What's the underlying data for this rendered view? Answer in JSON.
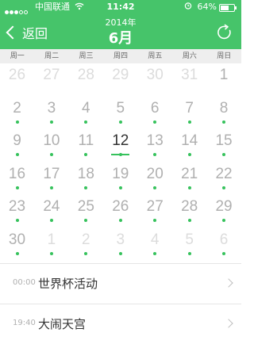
{
  "status_bar": {
    "carrier": "中国联通",
    "time": "11:42",
    "battery_pct": "64%",
    "battery_level": 0.64
  },
  "header": {
    "back_label": "返回",
    "year": "2014年",
    "month": "6月"
  },
  "weekdays": [
    "周一",
    "周二",
    "周三",
    "周四",
    "周五",
    "周六",
    "周日"
  ],
  "calendar": {
    "weeks": [
      [
        {
          "d": "26",
          "m": "prev"
        },
        {
          "d": "27",
          "m": "prev"
        },
        {
          "d": "28",
          "m": "prev"
        },
        {
          "d": "29",
          "m": "prev"
        },
        {
          "d": "30",
          "m": "prev"
        },
        {
          "d": "31",
          "m": "prev"
        },
        {
          "d": "1",
          "m": "cur"
        }
      ],
      [
        {
          "d": "2",
          "m": "cur"
        },
        {
          "d": "3",
          "m": "cur"
        },
        {
          "d": "4",
          "m": "cur"
        },
        {
          "d": "5",
          "m": "cur"
        },
        {
          "d": "6",
          "m": "cur"
        },
        {
          "d": "7",
          "m": "cur"
        },
        {
          "d": "8",
          "m": "cur"
        }
      ],
      [
        {
          "d": "9",
          "m": "cur"
        },
        {
          "d": "10",
          "m": "cur"
        },
        {
          "d": "11",
          "m": "cur"
        },
        {
          "d": "12",
          "m": "cur",
          "today": true
        },
        {
          "d": "13",
          "m": "cur"
        },
        {
          "d": "14",
          "m": "cur"
        },
        {
          "d": "15",
          "m": "cur"
        }
      ],
      [
        {
          "d": "16",
          "m": "cur"
        },
        {
          "d": "17",
          "m": "cur"
        },
        {
          "d": "18",
          "m": "cur"
        },
        {
          "d": "19",
          "m": "cur"
        },
        {
          "d": "20",
          "m": "cur"
        },
        {
          "d": "21",
          "m": "cur"
        },
        {
          "d": "22",
          "m": "cur"
        }
      ],
      [
        {
          "d": "23",
          "m": "cur"
        },
        {
          "d": "24",
          "m": "cur"
        },
        {
          "d": "25",
          "m": "cur"
        },
        {
          "d": "26",
          "m": "cur"
        },
        {
          "d": "27",
          "m": "cur"
        },
        {
          "d": "28",
          "m": "cur"
        },
        {
          "d": "29",
          "m": "cur"
        }
      ],
      [
        {
          "d": "30",
          "m": "cur"
        },
        {
          "d": "1",
          "m": "next"
        },
        {
          "d": "2",
          "m": "next"
        },
        {
          "d": "3",
          "m": "next"
        },
        {
          "d": "4",
          "m": "next"
        },
        {
          "d": "5",
          "m": "next"
        },
        {
          "d": "6",
          "m": "next"
        }
      ]
    ],
    "dot_rows": [
      1,
      2,
      3,
      4,
      5
    ]
  },
  "events": [
    {
      "time": "00:00",
      "name": "世界杯活动"
    },
    {
      "time": "19:40",
      "name": "大闹天宫"
    }
  ],
  "colors": {
    "accent": "#46c46a",
    "dot": "#36c25c"
  }
}
